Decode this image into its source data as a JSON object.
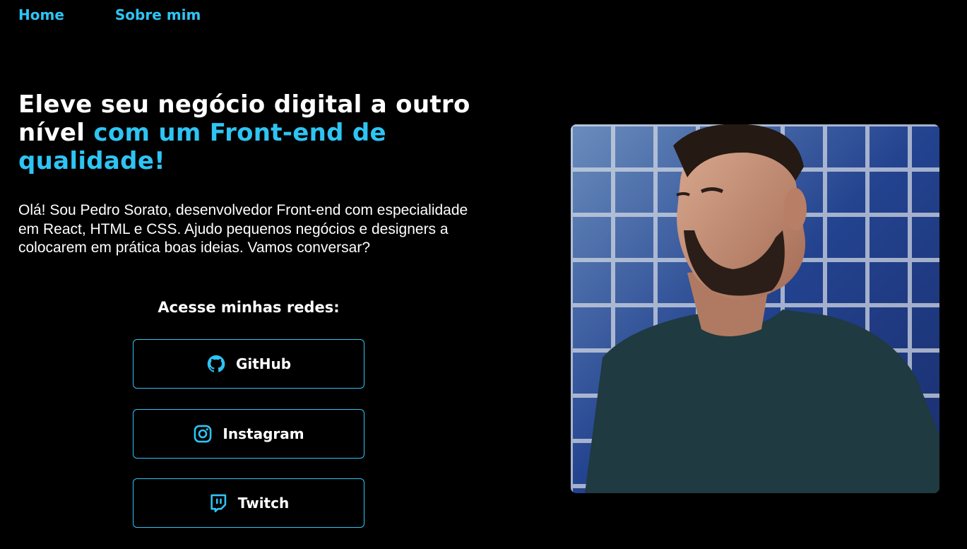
{
  "nav": {
    "items": [
      {
        "label": "Home"
      },
      {
        "label": "Sobre mim"
      }
    ]
  },
  "hero": {
    "headline_part1": "Eleve seu negócio digital a outro nível ",
    "headline_accent": "com um Front-end de qualidade!",
    "intro": "Olá! Sou Pedro Sorato, desenvolvedor Front-end com especialidade em React, HTML e CSS. Ajudo pequenos negócios e designers a colocarem em prática boas ideias. Vamos conversar?"
  },
  "social": {
    "title": "Acesse minhas redes:",
    "buttons": [
      {
        "label": "GitHub",
        "icon": "github-icon"
      },
      {
        "label": "Instagram",
        "icon": "instagram-icon"
      },
      {
        "label": "Twitch",
        "icon": "twitch-icon"
      }
    ]
  },
  "photo": {
    "icon": "profile-photo"
  },
  "colors": {
    "background": "#000000",
    "accent": "#2ec4f3",
    "text": "#ffffff"
  }
}
